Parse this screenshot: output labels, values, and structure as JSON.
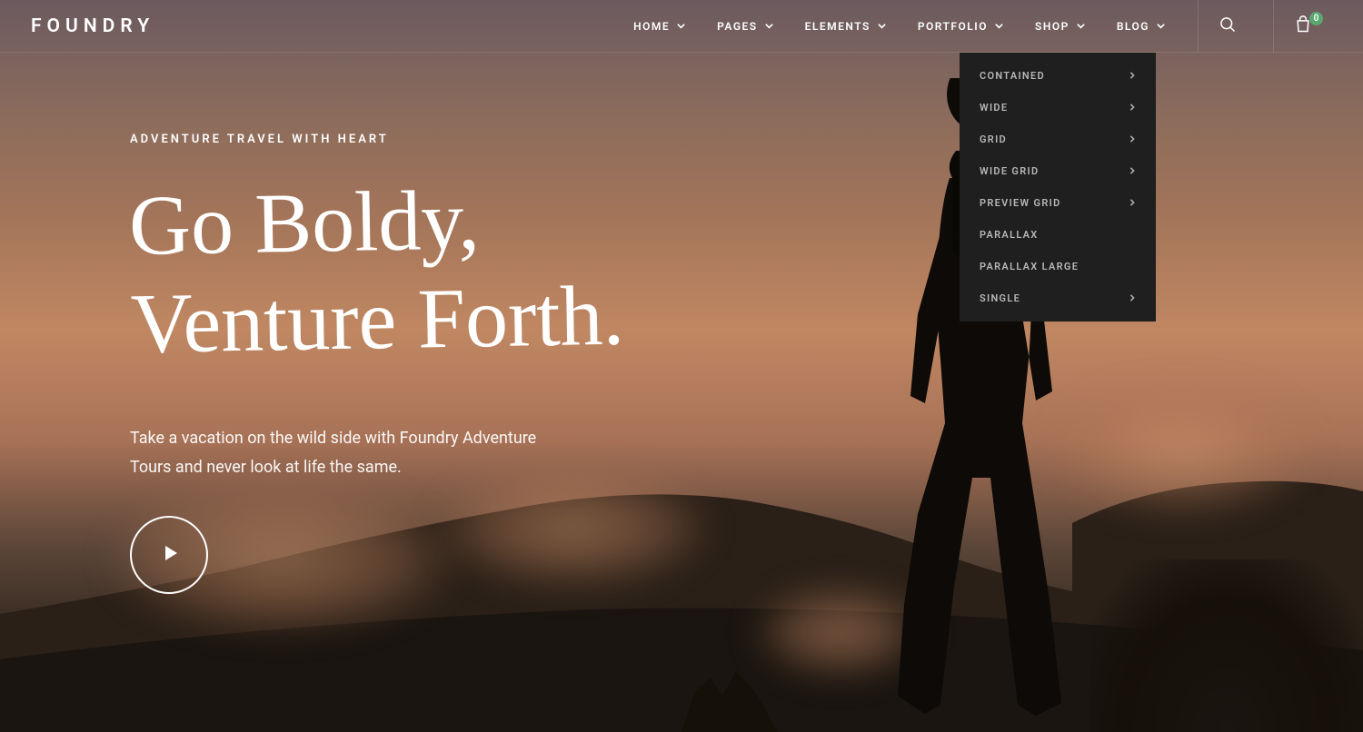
{
  "logo": "FOUNDRY",
  "nav": [
    {
      "label": "HOME",
      "hasSub": true
    },
    {
      "label": "PAGES",
      "hasSub": true
    },
    {
      "label": "ELEMENTS",
      "hasSub": true
    },
    {
      "label": "PORTFOLIO",
      "hasSub": true
    },
    {
      "label": "SHOP",
      "hasSub": true
    },
    {
      "label": "BLOG",
      "hasSub": true
    }
  ],
  "cartCount": "0",
  "dropdown": [
    {
      "label": "CONTAINED",
      "hasSub": true
    },
    {
      "label": "WIDE",
      "hasSub": true
    },
    {
      "label": "GRID",
      "hasSub": true
    },
    {
      "label": "WIDE GRID",
      "hasSub": true
    },
    {
      "label": "PREVIEW GRID",
      "hasSub": true
    },
    {
      "label": "PARALLAX",
      "hasSub": false
    },
    {
      "label": "PARALLAX LARGE",
      "hasSub": false
    },
    {
      "label": "SINGLE",
      "hasSub": true
    }
  ],
  "hero": {
    "tagline": "ADVENTURE TRAVEL WITH HEART",
    "headline_l1": "Go Boldy,",
    "headline_l2": "Venture Forth.",
    "subtext": "Take a vacation on the wild side with Foundry Adventure Tours and never look at life the same."
  }
}
